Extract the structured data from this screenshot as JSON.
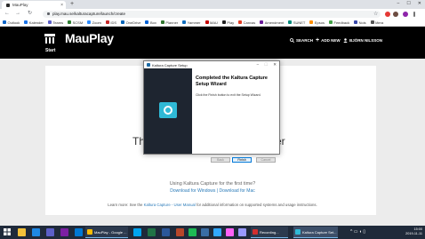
{
  "browser": {
    "tab_title": "MauPlay",
    "tab_close": "×",
    "new_tab": "+",
    "url": "play.mau.se/kalturacapture/launch/create",
    "nav": {
      "back": "←",
      "forward": "→",
      "reload": "↻"
    },
    "star": "☆",
    "window_controls": {
      "minimize": "–",
      "maximize": "☐",
      "close": "✕"
    },
    "bookmarks": [
      {
        "label": "Outlook",
        "color": "#0a64c8"
      },
      {
        "label": "Kalender",
        "color": "#1a73e8"
      },
      {
        "label": "Teams",
        "color": "#5b5fc7"
      },
      {
        "label": "SCSM",
        "color": "#2e7d32"
      },
      {
        "label": "Zoom",
        "color": "#2d8cff"
      },
      {
        "label": "IDS",
        "color": "#c62828"
      },
      {
        "label": "OneDrive",
        "color": "#0364b8"
      },
      {
        "label": "Box",
        "color": "#0061d5"
      },
      {
        "label": "Planner",
        "color": "#31752f"
      },
      {
        "label": "Yammer",
        "color": "#106ebe"
      },
      {
        "label": "MAU",
        "color": "#c50000"
      },
      {
        "label": "Play",
        "color": "#222222"
      },
      {
        "label": "Canvas",
        "color": "#e13c23"
      },
      {
        "label": "Amendment",
        "color": "#6a1b9a"
      },
      {
        "label": "SUNET",
        "color": "#00897b"
      },
      {
        "label": "Epsos",
        "color": "#ff8f00"
      },
      {
        "label": "Feedback",
        "color": "#43a047"
      },
      {
        "label": "Nois",
        "color": "#3949ab"
      },
      {
        "label": "Mera",
        "color": "#555555"
      }
    ],
    "extensions": [
      "#e53935",
      "#6d4c41",
      "#8e24aa",
      "#757575"
    ]
  },
  "site": {
    "brand": "MauPlay",
    "start_label": "Start",
    "search_label": "SEARCH",
    "add_new_label": "ADD NEW",
    "user_label": "BJÖRN NILSSON"
  },
  "page": {
    "big_title_left": "The",
    "big_title_right": "er",
    "first_time": "Using Kaltura Capture for the first time?",
    "download_windows": "Download for Windows",
    "download_sep": " | ",
    "download_mac": "Download for Mac",
    "learn_prefix": "Learn more: See the ",
    "learn_link": "Kaltura Capture - User Manual",
    "learn_suffix": " for additional information on supported systems and usage instructions."
  },
  "dialog": {
    "title": "Kaltura Capture Setup",
    "heading": "Completed the Kaltura Capture Setup Wizard",
    "body": "Click the Finish button to exit the Setup Wizard.",
    "back": "Back",
    "finish": "Finish",
    "cancel": "Cancel",
    "wc_min": "–",
    "wc_max": "☐",
    "wc_close": "✕"
  },
  "taskbar": {
    "tasks": [
      {
        "label": "MauPlay - Google ...",
        "color": "#fbbc05"
      },
      {
        "label": "Recording...",
        "color": "#d32f2f"
      },
      {
        "label": "Kaltura Capture Set...",
        "color": "#2fb9d6"
      }
    ],
    "time": "15:00",
    "date": "2019-11-11"
  },
  "colors": {
    "header_bg": "#000000",
    "link": "#2b7bb9",
    "kaltura_accent": "#2fb9d6"
  }
}
